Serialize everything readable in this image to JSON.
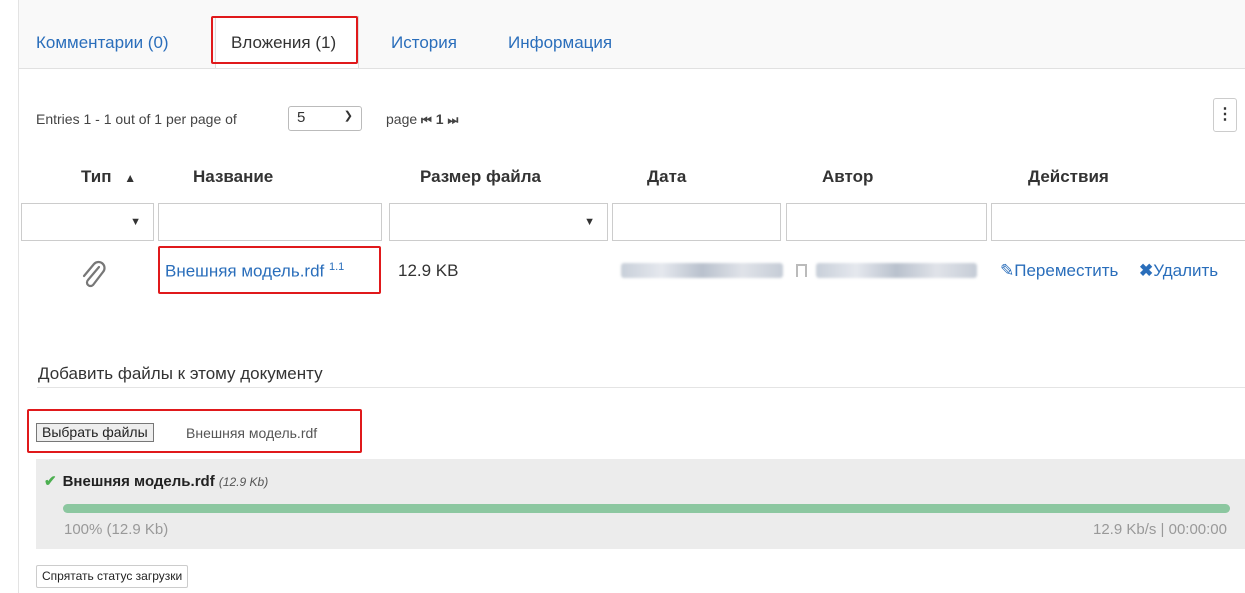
{
  "tabs": [
    {
      "label": "Комментарии (0)"
    },
    {
      "label": "Вложения (1)"
    },
    {
      "label": "История"
    },
    {
      "label": "Информация"
    }
  ],
  "pager": {
    "entries_text": "Entries 1 - 1 out of 1 per page of",
    "per_page": "5",
    "page_label": "page",
    "first_icon": "first-page-icon",
    "page_number": "1",
    "last_icon": "last-page-icon"
  },
  "table": {
    "columns": [
      "Тип",
      "Название",
      "Размер файла",
      "Дата",
      "Автор",
      "Действия"
    ],
    "sort_icon": "sort-asc-icon",
    "rows": [
      {
        "type_icon": "paperclip-icon",
        "name": "Внешняя модель.rdf",
        "version": "1.1",
        "size": "12.9 KB",
        "actions": {
          "move": "Переместить",
          "delete": "Удалить"
        }
      }
    ]
  },
  "upload": {
    "add_label": "Добавить файлы к этому документу",
    "choose_button": "Выбрать файлы",
    "chosen_file": "Внешняя модель.rdf",
    "status": {
      "file_name": "Внешняя модель.rdf",
      "file_size": "(12.9 Kb)",
      "progress": 1.0,
      "percent_text": "100%  (12.9 Kb)",
      "speed_text": "12.9 Kb/s | 00:00:00"
    },
    "hide_button": "Спрятать статус загрузки"
  },
  "colors": {
    "link": "#2a6ebb",
    "highlight": "#e0191b",
    "progress": "#8cc7a0"
  }
}
